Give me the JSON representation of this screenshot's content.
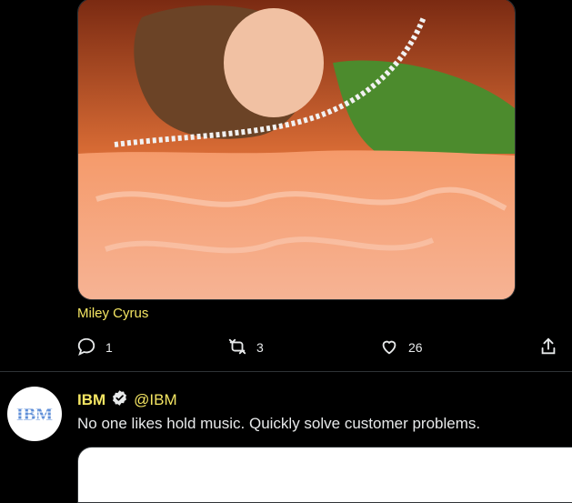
{
  "tweet1": {
    "media_caption": "Miley Cyrus",
    "actions": {
      "reply_count": "1",
      "retweet_count": "3",
      "like_count": "26"
    }
  },
  "tweet2": {
    "avatar_text": "IBM",
    "display_name": "IBM",
    "handle": "@IBM",
    "verified": true,
    "text": "No one likes hold music. Quickly solve customer problems."
  },
  "colors": {
    "accent": "#f5e663",
    "background": "#000000",
    "ibm_blue": "#5f8fd8"
  }
}
